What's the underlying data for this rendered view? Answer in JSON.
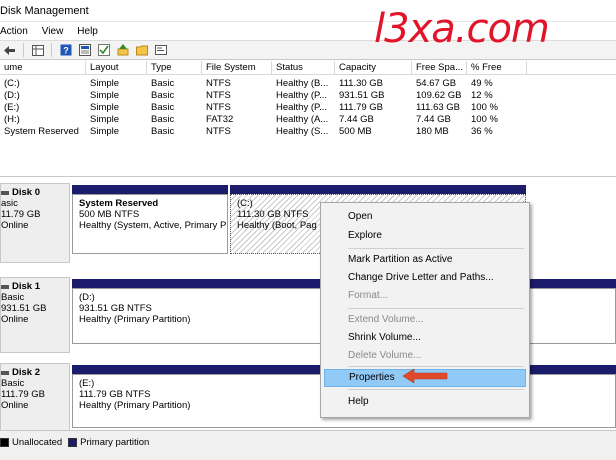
{
  "window": {
    "title": "Disk Management"
  },
  "menu": [
    "Action",
    "View",
    "Help"
  ],
  "toolbar": [
    "back-arrow-icon",
    "forward-arrow-icon",
    "grid-icon",
    "help-icon",
    "list-icon",
    "check-icon",
    "up-icon",
    "folder-icon",
    "properties-icon"
  ],
  "volumes": {
    "headers": [
      "ume",
      "Layout",
      "Type",
      "File System",
      "Status",
      "Capacity",
      "Free Spa...",
      "% Free"
    ],
    "rows": [
      [
        "(C:)",
        "Simple",
        "Basic",
        "NTFS",
        "Healthy (B...",
        "111.30 GB",
        "54.67 GB",
        "49 %"
      ],
      [
        "(D:)",
        "Simple",
        "Basic",
        "NTFS",
        "Healthy (P...",
        "931.51 GB",
        "109.62 GB",
        "12 %"
      ],
      [
        "(E:)",
        "Simple",
        "Basic",
        "NTFS",
        "Healthy (P...",
        "111.79 GB",
        "111.63 GB",
        "100 %"
      ],
      [
        "(H:)",
        "Simple",
        "Basic",
        "FAT32",
        "Healthy (A...",
        "7.44 GB",
        "7.44 GB",
        "100 %"
      ],
      [
        "System Reserved",
        "Simple",
        "Basic",
        "NTFS",
        "Healthy (S...",
        "500 MB",
        "180 MB",
        "36 %"
      ]
    ]
  },
  "disks": [
    {
      "name": "Disk 0",
      "type": "asic",
      "size": "11.79 GB",
      "state": "Online",
      "partitions": [
        {
          "name": "System Reserved",
          "size": "500 MB NTFS",
          "status": "Healthy (System, Active, Primary P"
        },
        {
          "name": "(C:)",
          "size": "111.30 GB NTFS",
          "status": "Healthy (Boot, Pag"
        }
      ]
    },
    {
      "name": "Disk 1",
      "type": "Basic",
      "size": "931.51 GB",
      "state": "Online",
      "partitions": [
        {
          "name": "(D:)",
          "size": "931.51 GB NTFS",
          "status": "Healthy (Primary Partition)"
        }
      ]
    },
    {
      "name": "Disk 2",
      "type": "Basic",
      "size": "111.79 GB",
      "state": "Online",
      "partitions": [
        {
          "name": "(E:)",
          "size": "111.79 GB NTFS",
          "status": "Healthy (Primary Partition)"
        }
      ]
    }
  ],
  "context_menu": {
    "items": [
      {
        "label": "Open",
        "enabled": true
      },
      {
        "label": "Explore",
        "enabled": true
      },
      {
        "label": "Mark Partition as Active",
        "enabled": true
      },
      {
        "label": "Change Drive Letter and Paths...",
        "enabled": true
      },
      {
        "label": "Format...",
        "enabled": false
      },
      {
        "label": "Extend Volume...",
        "enabled": false
      },
      {
        "label": "Shrink Volume...",
        "enabled": true
      },
      {
        "label": "Delete Volume...",
        "enabled": false
      },
      {
        "label": "Properties",
        "enabled": true,
        "highlighted": true
      },
      {
        "label": "Help",
        "enabled": true
      }
    ]
  },
  "legend": [
    {
      "label": "Unallocated",
      "color": "#000000"
    },
    {
      "label": "Primary partition",
      "color": "#1c1c6c"
    }
  ],
  "logo": "l3xa.com",
  "colors": {
    "partition_bar": "#1c1c6c",
    "highlight": "#91c9f7",
    "arrow": "#e04a2a",
    "logo": "#e2142a"
  }
}
